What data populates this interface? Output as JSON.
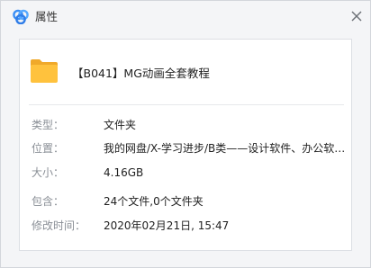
{
  "dialog": {
    "title": "属性",
    "close_label": "×"
  },
  "icons": {
    "app_logo": "baidu-netdisk-logo",
    "close": "close-icon",
    "folder": "folder-icon"
  },
  "colors": {
    "folder_yellow": "#ffc23d",
    "logo_blue": "#3a8ff5",
    "label_gray": "#8a8f96",
    "value_black": "#222222"
  },
  "file": {
    "name": "【B041】MG动画全套教程"
  },
  "properties": [
    {
      "label": "类型：",
      "value": "文件夹"
    },
    {
      "label": "位置：",
      "value": "我的网盘/X-学习进步/B类——设计软件、办公软件..."
    },
    {
      "label": "大小：",
      "value": "4.16GB"
    },
    {
      "label": "包含：",
      "value": "24个文件,0个文件夹"
    },
    {
      "label": "修改时间：",
      "value": "2020年02月21日, 15:47"
    }
  ]
}
